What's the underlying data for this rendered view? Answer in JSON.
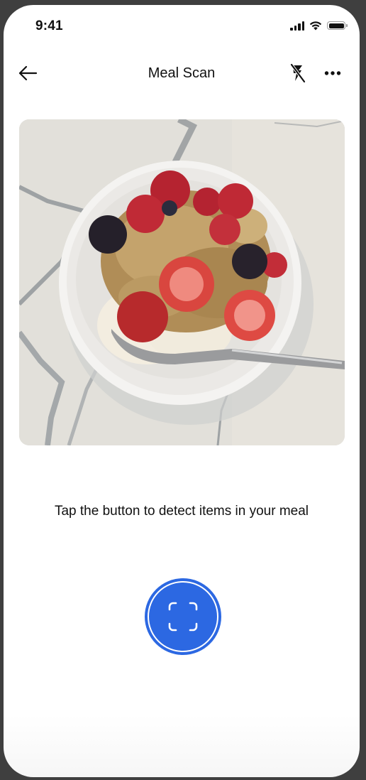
{
  "status_bar": {
    "time": "9:41",
    "icons": [
      "cellular-signal-icon",
      "wifi-icon",
      "battery-icon"
    ]
  },
  "nav": {
    "title": "Meal Scan",
    "back_icon": "arrow-left-icon",
    "flash_icon": "flash-off-icon",
    "more_icon": "more-horizontal-icon"
  },
  "photo": {
    "alt": "Bowl of yogurt with granola, strawberries, raspberries and blackberries on a marble countertop"
  },
  "instruction": {
    "text": "Tap the button to detect items in your meal"
  },
  "scan_button": {
    "icon": "scan-frame-icon",
    "aria_label": "Scan meal"
  },
  "colors": {
    "accent": "#2c68e2",
    "frame": "#3f3f3f",
    "text": "#111111"
  }
}
